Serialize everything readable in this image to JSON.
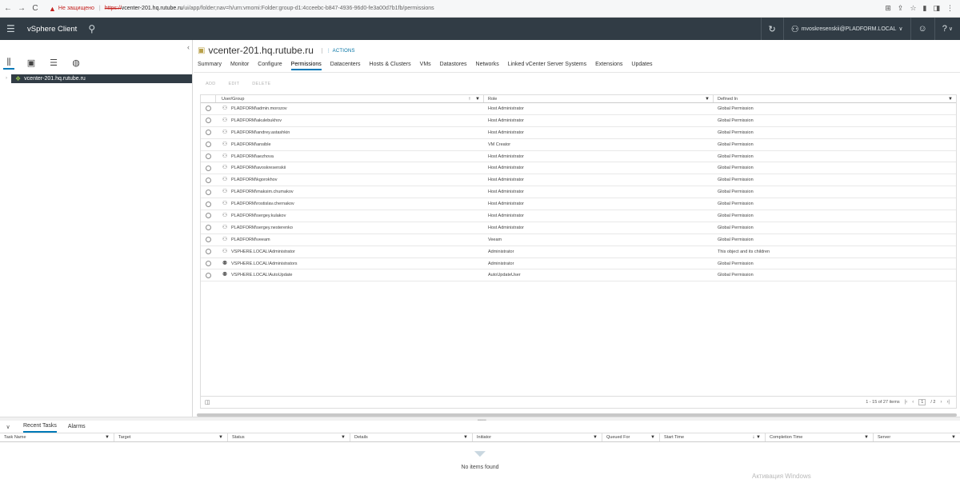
{
  "browser": {
    "back_icon": "←",
    "forward_icon": "→",
    "reload_icon": "C",
    "warning_icon": "▲",
    "insecure_label": "Не защищено",
    "separator": "|",
    "url_scheme": "https://",
    "url_host": "vcenter-201.hq.rutube.ru",
    "url_path": "/ui/app/folder;nav=h/urn:vmomi:Folder:group-d1:4cceebc-b847-4936-96d0-fe3a00d7b1fb/permissions",
    "icons": [
      "⊞",
      "⇪",
      "☆",
      "▮",
      "◨",
      "⋮"
    ]
  },
  "header": {
    "menu_icon": "☰",
    "app_title": "vSphere Client",
    "search_icon": "⚲",
    "refresh_icon": "↻",
    "user_icon": "⚇",
    "user_label": "mvoskresenskii@PLADFORM.LOCAL",
    "user_caret": "∨",
    "feedback_icon": "☺",
    "help_icon": "?",
    "help_caret": "∨"
  },
  "left_nav": {
    "collapse_icon": "‹",
    "icons": [
      "⫼",
      "▣",
      "☰",
      "◍"
    ],
    "tree_toggle": "›",
    "tree_item_icon": "❖",
    "tree_item_label": "vcenter-201.hq.rutube.ru"
  },
  "object": {
    "icon": "▣",
    "title": "vcenter-201.hq.rutube.ru",
    "actions_label": "⋮ ACTIONS"
  },
  "tabs": [
    "Summary",
    "Monitor",
    "Configure",
    "Permissions",
    "Datacenters",
    "Hosts & Clusters",
    "VMs",
    "Datastores",
    "Networks",
    "Linked vCenter Server Systems",
    "Extensions",
    "Updates"
  ],
  "active_tab": "Permissions",
  "toolbar": {
    "add": "ADD",
    "edit": "EDIT",
    "delete": "DELETE"
  },
  "grid": {
    "columns": {
      "user": "User/Group",
      "role": "Role",
      "defined_in": "Defined In"
    },
    "sort_icon": "↑",
    "filter_icon": "▼",
    "rows": [
      {
        "icon": "⚇",
        "user": "PLADFORM\\admin.morozov",
        "role": "Host Administrator",
        "defined_in": "Global Permission"
      },
      {
        "icon": "⚇",
        "user": "PLADFORM\\akulebukhov",
        "role": "Host Administrator",
        "defined_in": "Global Permission"
      },
      {
        "icon": "⚇",
        "user": "PLADFORM\\andrey.astashkin",
        "role": "Host Administrator",
        "defined_in": "Global Permission"
      },
      {
        "icon": "⚇",
        "user": "PLADFORM\\ansible",
        "role": "VM Creator",
        "defined_in": "Global Permission"
      },
      {
        "icon": "⚇",
        "user": "PLADFORM\\aezhova",
        "role": "Host Administrator",
        "defined_in": "Global Permission"
      },
      {
        "icon": "⚇",
        "user": "PLADFORM\\avoskresenskii",
        "role": "Host Administrator",
        "defined_in": "Global Permission"
      },
      {
        "icon": "⚇",
        "user": "PLADFORM\\kgorokhov",
        "role": "Host Administrator",
        "defined_in": "Global Permission"
      },
      {
        "icon": "⚇",
        "user": "PLADFORM\\maksim.chumakov",
        "role": "Host Administrator",
        "defined_in": "Global Permission"
      },
      {
        "icon": "⚇",
        "user": "PLADFORM\\rostislav.chernakov",
        "role": "Host Administrator",
        "defined_in": "Global Permission"
      },
      {
        "icon": "⚇",
        "user": "PLADFORM\\sergey.kulakov",
        "role": "Host Administrator",
        "defined_in": "Global Permission"
      },
      {
        "icon": "⚇",
        "user": "PLADFORM\\sergey.nesterenko",
        "role": "Host Administrator",
        "defined_in": "Global Permission"
      },
      {
        "icon": "⚇",
        "user": "PLADFORM\\veeam",
        "role": "Veeam",
        "defined_in": "Global Permission"
      },
      {
        "icon": "⚇",
        "user": "VSPHERE.LOCAL\\Administrator",
        "role": "Administrator",
        "defined_in": "This object and its children"
      },
      {
        "icon": "⚉",
        "user": "VSPHERE.LOCAL\\Administrators",
        "role": "Administrator",
        "defined_in": "Global Permission"
      },
      {
        "icon": "⚉",
        "user": "VSPHERE.LOCAL\\AutoUpdate",
        "role": "AutoUpdateUser",
        "defined_in": "Global Permission"
      }
    ],
    "footer": {
      "column_toggle_icon": "◫",
      "count_label": "1 - 15 of 27 items",
      "first_icon": "|‹",
      "prev_icon": "‹",
      "page_current": "1",
      "page_total": "/ 2",
      "next_icon": "›",
      "last_icon": "›|"
    }
  },
  "tasks": {
    "collapse_icon": "∨",
    "splitter_grip": "═══",
    "tabs": [
      "Recent Tasks",
      "Alarms"
    ],
    "active_tab": "Recent Tasks",
    "columns": [
      "Task Name",
      "Target",
      "Status",
      "Details",
      "Initiator",
      "Queued For",
      "Start Time",
      "Completion Time",
      "Server"
    ],
    "start_time_sort_icon": "↓",
    "empty_icon": "⏷",
    "empty_text": "No items found",
    "watermark": "Активация Windows"
  },
  "colors": {
    "header_bg": "#313c45",
    "accent": "#0079b8",
    "insecure": "#c5221f"
  }
}
